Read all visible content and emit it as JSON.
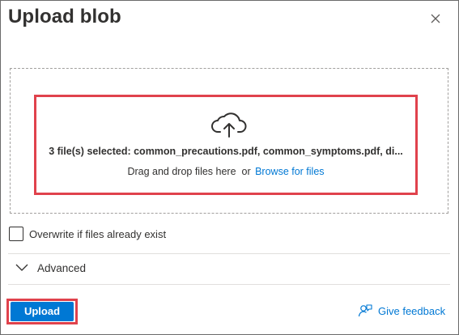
{
  "panel": {
    "title": "Upload blob",
    "close_icon": "close-icon"
  },
  "dropzone": {
    "icon": "cloud-upload-icon",
    "files_selected": "3 file(s) selected: common_precautions.pdf, common_symptoms.pdf, di...",
    "drag_text": "Drag and drop files here  or",
    "browse_label": "Browse for files"
  },
  "options": {
    "overwrite_label": "Overwrite if files already exist",
    "overwrite_checked": false
  },
  "advanced": {
    "label": "Advanced",
    "icon": "chevron-down-icon"
  },
  "footer": {
    "upload_label": "Upload",
    "feedback_label": "Give feedback",
    "feedback_icon": "feedback-icon"
  },
  "colors": {
    "accent": "#0078d4",
    "highlight": "#e0424c"
  }
}
